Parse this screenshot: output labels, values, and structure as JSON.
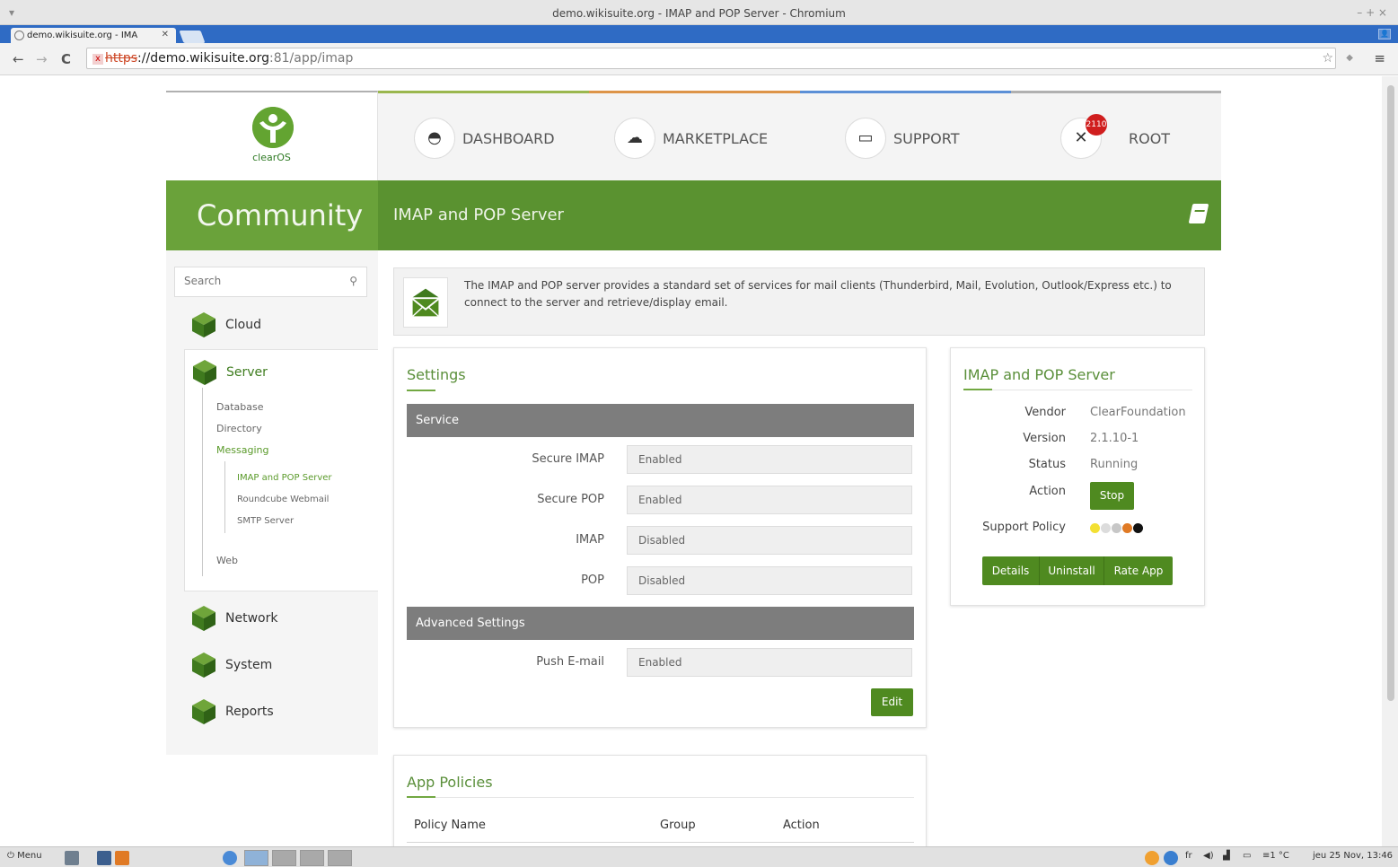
{
  "browser": {
    "window_title": "demo.wikisuite.org - IMAP and POP Server - Chromium",
    "window_controls": "– + ×",
    "tab_title": "demo.wikisuite.org - IMA",
    "url": {
      "scheme": "https",
      "host": "://demo.wikisuite.org",
      "path": ":81/app/imap"
    }
  },
  "header": {
    "logo_text": "clearOS",
    "nav": [
      {
        "label": "DASHBOARD",
        "icon": "dashboard-icon"
      },
      {
        "label": "MARKETPLACE",
        "icon": "cloud-download-icon"
      },
      {
        "label": "SUPPORT",
        "icon": "inbox-icon"
      },
      {
        "label": "ROOT",
        "icon": "tools-icon"
      }
    ],
    "notification_count": "2110",
    "accent_colors": [
      "#9ab74e",
      "#dd9448",
      "#5b8fd6",
      "#b0b0b0"
    ]
  },
  "banner": {
    "edition": "Community",
    "page_title": "IMAP and POP Server",
    "color": "#5a9230"
  },
  "sidebar": {
    "search_placeholder": "Search",
    "categories": [
      "Cloud",
      "Server",
      "Network",
      "System",
      "Reports"
    ],
    "server_sub": [
      "Database",
      "Directory",
      "Messaging",
      "Web"
    ],
    "messaging_sub": [
      "IMAP and POP Server",
      "Roundcube Webmail",
      "SMTP Server"
    ]
  },
  "intro": {
    "text": "The IMAP and POP server provides a standard set of services for mail clients (Thunderbird, Mail, Evolution, Outlook/Express etc.) to connect to the server and retrieve/display email."
  },
  "settings": {
    "title": "Settings",
    "service_heading": "Service",
    "fields": [
      {
        "label": "Secure IMAP",
        "value": "Enabled"
      },
      {
        "label": "Secure POP",
        "value": "Enabled"
      },
      {
        "label": "IMAP",
        "value": "Disabled"
      },
      {
        "label": "POP",
        "value": "Disabled"
      }
    ],
    "advanced_heading": "Advanced Settings",
    "advanced_fields": [
      {
        "label": "Push E-mail",
        "value": "Enabled"
      }
    ],
    "edit_label": "Edit"
  },
  "app_info": {
    "title": "IMAP and POP Server",
    "vendor_label": "Vendor",
    "vendor": "ClearFoundation",
    "version_label": "Version",
    "version": "2.1.10-1",
    "status_label": "Status",
    "status": "Running",
    "action_label": "Action",
    "stop_label": "Stop",
    "support_label": "Support Policy",
    "support_dots": [
      "#f3e033",
      "#dcdcdc",
      "#c7c7c7",
      "#e07a25",
      "#111111"
    ],
    "buttons": [
      "Details",
      "Uninstall",
      "Rate App"
    ]
  },
  "policies": {
    "title": "App Policies",
    "columns": [
      "Policy Name",
      "Group",
      "Action"
    ]
  },
  "taskbar": {
    "menu_label": "Menu",
    "tray_text": "fr",
    "weather": "1 °C",
    "clock": "jeu 25 Nov, 13:46"
  }
}
